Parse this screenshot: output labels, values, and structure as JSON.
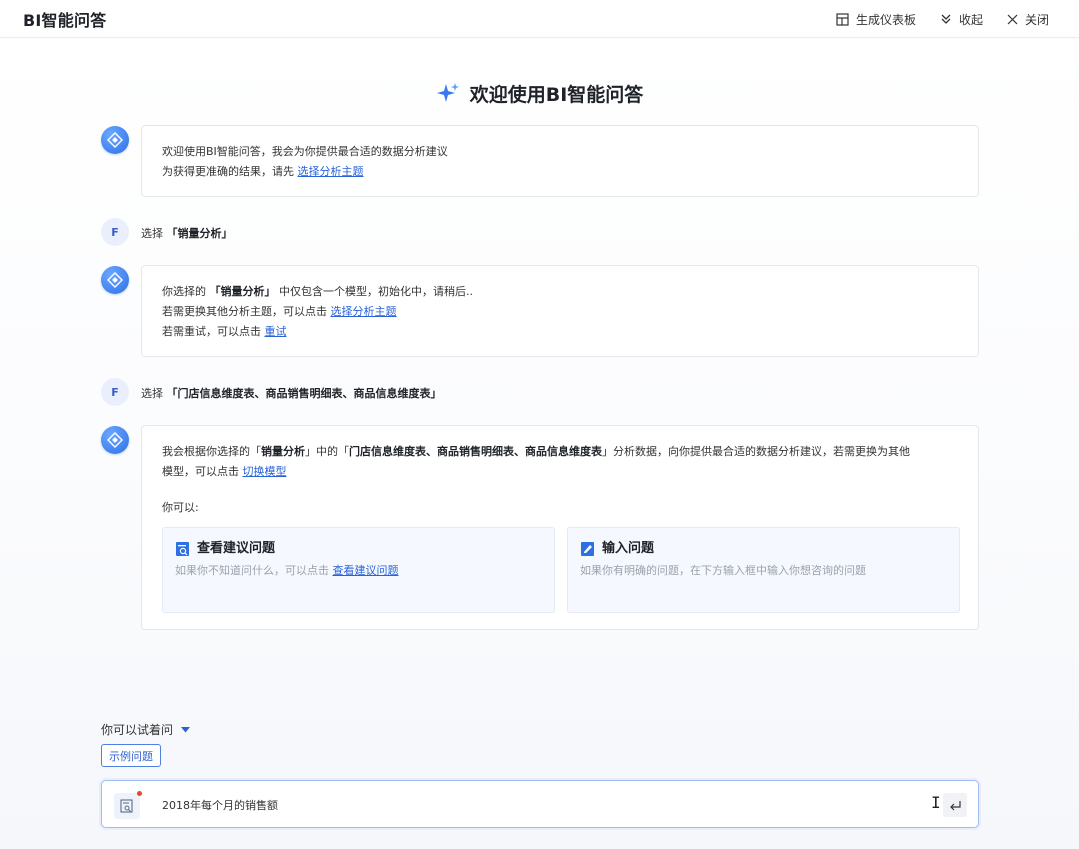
{
  "header": {
    "title": "BI智能问答",
    "actions": {
      "dashboard": "生成仪表板",
      "collapse": "收起",
      "close": "关闭"
    }
  },
  "welcome": {
    "title": "欢迎使用BI智能问答"
  },
  "messages": {
    "bot1": {
      "line1": "欢迎使用BI智能问答，我会为你提供最合适的数据分析建议",
      "line2_pre": "为获得更准确的结果，请先 ",
      "line2_link": "选择分析主题"
    },
    "user1": {
      "avatar": "F",
      "prefix": "选择",
      "value": "「销量分析」"
    },
    "bot2": {
      "l1_pre": "你选择的 ",
      "l1_bold": "「销量分析」",
      "l1_post": " 中仅包含一个模型，初始化中，请稍后..",
      "l2_pre": "若需更换其他分析主题，可以点击 ",
      "l2_link": "选择分析主题",
      "l3_pre": "若需重试，可以点击 ",
      "l3_link": "重试"
    },
    "user2": {
      "avatar": "F",
      "prefix": "选择",
      "value": "「门店信息维度表、商品销售明细表、商品信息维度表」"
    },
    "bot3": {
      "p_a": "我会根据你选择的「",
      "p_b": "销量分析",
      "p_c": "」中的「",
      "p_d": "门店信息维度表、商品销售明细表、商品信息维度表",
      "p_e": "」分析数据，向你提供最合适的数据分析建议，若需更换为其他",
      "p2_pre": "模型，可以点击 ",
      "p2_link": "切换模型",
      "you_can": "你可以:",
      "card1": {
        "title": "查看建议问题",
        "desc_pre": "如果你不知道问什么，可以点击 ",
        "desc_link": "查看建议问题"
      },
      "card2": {
        "title": "输入问题",
        "desc": "如果你有明确的问题，在下方输入框中输入你想咨询的问题"
      }
    }
  },
  "suggest": {
    "label": "你可以试着问",
    "sample_button": "示例问题"
  },
  "input": {
    "value": "2018年每个月的销售额"
  }
}
